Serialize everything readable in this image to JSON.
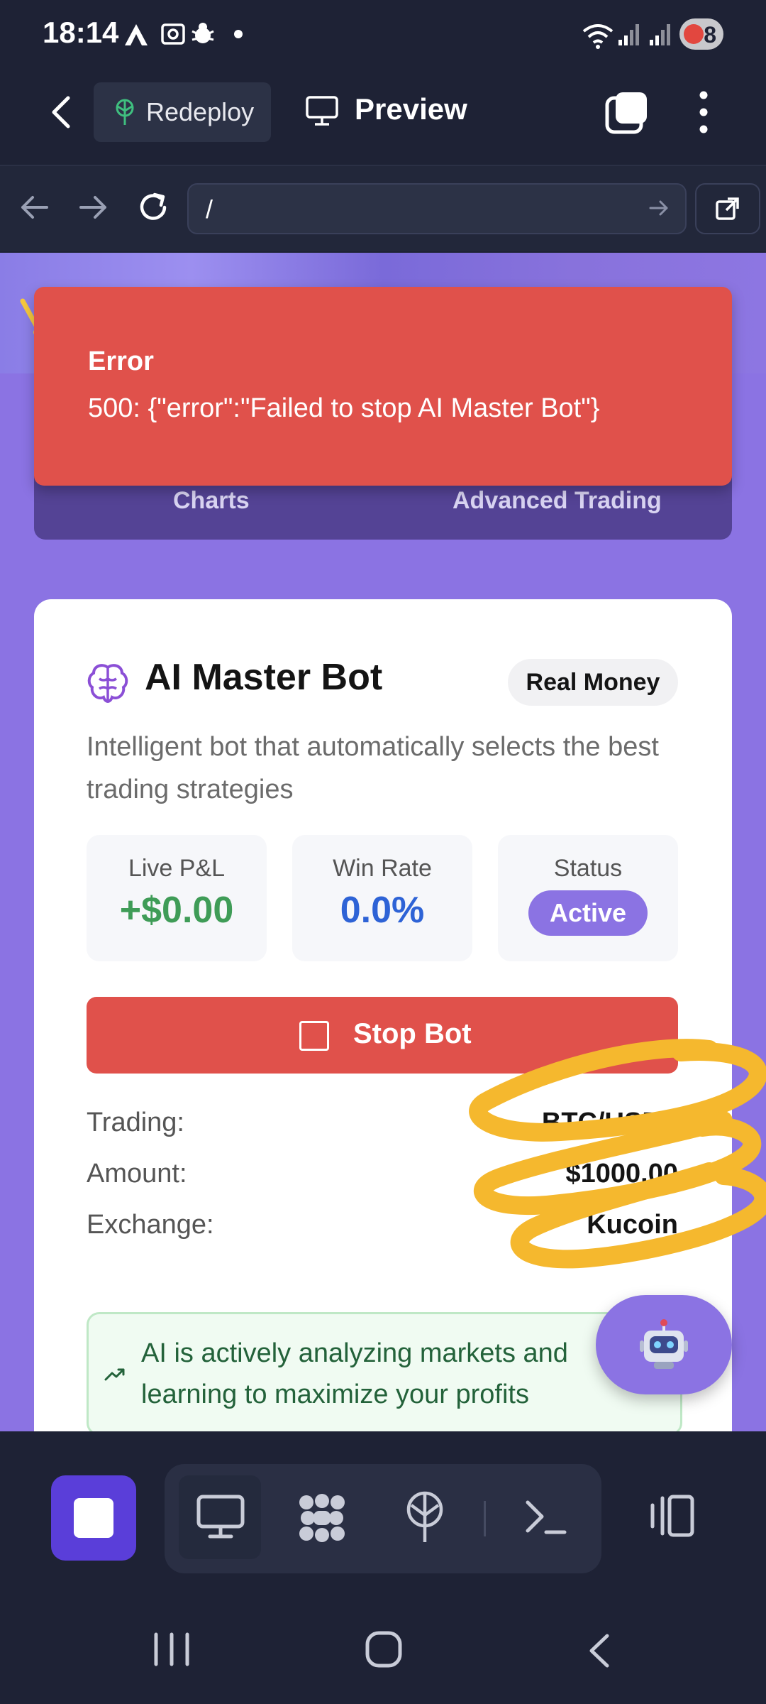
{
  "status_bar": {
    "time": "18:14",
    "battery": "8"
  },
  "app_bar": {
    "redeploy_label": "Redeploy",
    "preview_label": "Preview"
  },
  "url_bar": {
    "value": "/"
  },
  "error_toast": {
    "title": "Error",
    "message": "500: {\"error\":\"Failed to stop AI Master Bot\"}"
  },
  "nav_tabs": [
    "Charts",
    "Advanced Trading"
  ],
  "bot_card": {
    "title": "AI Master Bot",
    "badge": "Real Money",
    "description": "Intelligent bot that automatically selects the best trading strategies",
    "stats": [
      {
        "label": "Live P&L",
        "value": "+$0.00",
        "color": "#3f9c57"
      },
      {
        "label": "Win Rate",
        "value": "0.0%",
        "color": "#2e63d6"
      },
      {
        "label": "Status",
        "value": "Active"
      }
    ],
    "stop_button": "Stop Bot",
    "info": [
      {
        "label": "Trading:",
        "value": "BTC/USDT"
      },
      {
        "label": "Amount:",
        "value": "$1000.00"
      },
      {
        "label": "Exchange:",
        "value": "Kucoin"
      }
    ],
    "ai_banner": "AI is actively analyzing markets and learning to maximize your profits"
  },
  "colors": {
    "accent": "#8b73e3",
    "error": "#e0514b",
    "success": "#3f9c57",
    "info": "#2e63d6",
    "annotation": "#f5b82e"
  }
}
